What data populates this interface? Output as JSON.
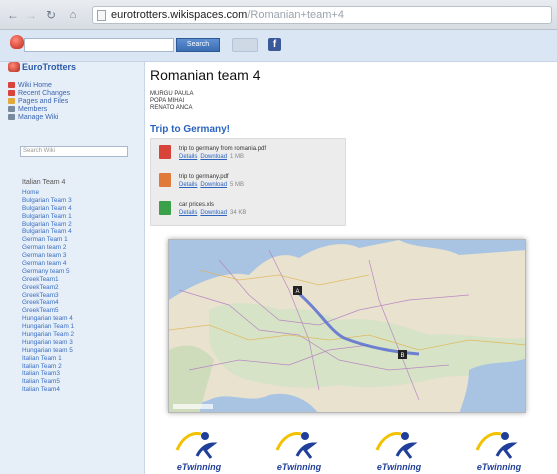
{
  "browser": {
    "url_domain": "eurotrotters.wikispaces.com",
    "url_path": "/Romanian+team+4"
  },
  "wiki_header": {
    "search_button": "Search"
  },
  "sidebar": {
    "space_name": "EuroTrotters",
    "links": [
      {
        "label": "Wiki Home",
        "icon": "home-icon",
        "color": "#d9443a"
      },
      {
        "label": "Recent Changes",
        "icon": "recent-changes-icon",
        "color": "#d9443a"
      },
      {
        "label": "Pages and Files",
        "icon": "pages-files-icon",
        "color": "#e0a93a"
      },
      {
        "label": "Members",
        "icon": "members-icon",
        "color": "#7a8a9e"
      },
      {
        "label": "Manage Wiki",
        "icon": "manage-wiki-icon",
        "color": "#7a8a9e"
      }
    ],
    "search_placeholder": "Search Wiki",
    "nav_title": "Italian Team 4",
    "nav_items": [
      "Home",
      "Bulgarian Team 3",
      "Bulgarian Team 4",
      "Bulgarian Team 1",
      "Bulgarian Team 2",
      "Bulgarian Team 4",
      "German Team 1",
      "German team 2",
      "German team 3",
      "German team 4",
      "Germany team 5",
      "GreekTeam1",
      "GreekTeam2",
      "GreekTeam3",
      "GreekTeam4",
      "GreekTeam5",
      "Hungarian team 4",
      "Hungarian Team 1",
      "Hungarian Team 2",
      "Hungarian team 3",
      "Hungarian team 5",
      "Italian Team 1",
      "Italian Team 2",
      "Italian Team3",
      "Italian Team5",
      "Italian Team4"
    ]
  },
  "main": {
    "title": "Romanian team 4",
    "members": [
      "MURGU PAULA",
      "POPA MIHAI",
      "RENATO ANCA"
    ],
    "subheading": "Trip to Germany!",
    "files": [
      {
        "name": "trip to germany from romania.pdf",
        "icon": "pdf-file-icon",
        "icon_color": "#d9443a",
        "details": "Details",
        "download": "Download",
        "size": "1 MB"
      },
      {
        "name": "trip to germany.pdf",
        "icon": "pdf-file-icon",
        "icon_color": "#e07a3a",
        "details": "Details",
        "download": "Download",
        "size": "5 MB"
      },
      {
        "name": "car prices.xls",
        "icon": "spreadsheet-file-icon",
        "icon_color": "#3aa049",
        "details": "Details",
        "download": "Download",
        "size": "34 KB"
      }
    ],
    "map_markers": [
      "A",
      "B"
    ]
  },
  "logos": [
    {
      "text": "eTwinning"
    },
    {
      "text": "eTwinning"
    },
    {
      "text": "eTwinning"
    },
    {
      "text": "eTwinning"
    }
  ],
  "colors": {
    "link": "#2a64c0",
    "sidebar_bg": "#e6eef8",
    "header_bg": "#dbe6f4"
  }
}
